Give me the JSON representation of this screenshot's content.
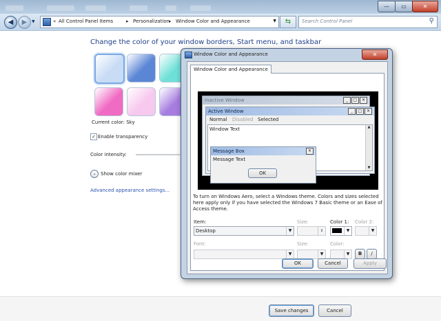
{
  "window": {
    "toolbar_ghosts": [
      "Arrange by",
      "Organize",
      "Include in library",
      "Share with",
      "Slide show",
      "Burn",
      "New folder"
    ],
    "min_glyph": "—",
    "max_glyph": "▭",
    "close_glyph": "✕"
  },
  "address": {
    "chevrons": "«",
    "crumbs": [
      "All Control Panel Items",
      "Personalization",
      "Window Color and Appearance"
    ],
    "sep": "▸",
    "search_placeholder": "Search Control Panel"
  },
  "main": {
    "title": "Change the color of your window borders, Start menu, and taskbar",
    "swatch_colors": [
      "#c9dcf6",
      "#5b86d6",
      "#6fe0d8",
      "#f06bc3",
      "#f7c9ee",
      "#a77de0"
    ],
    "current_color_label": "Current color:",
    "current_color_value": "Sky",
    "enable_transparency": "Enable transparency",
    "color_intensity": "Color intensity:",
    "show_color_mixer": "Show color mixer",
    "advanced_link": "Advanced appearance settings...",
    "save_button": "Save changes",
    "cancel_button": "Cancel"
  },
  "dialog": {
    "title": "Window Color and Appearance",
    "close_glyph": "✕",
    "tab": "Window Color and Appearance",
    "preview": {
      "inactive_title": "Inactive Window",
      "active_title": "Active Window",
      "menu_normal": "Normal",
      "menu_disabled": "Disabled",
      "menu_selected": "Selected",
      "window_text": "Window Text",
      "message_box_title": "Message Box",
      "message_text": "Message Text",
      "ok": "OK"
    },
    "info_text": "To turn on Windows Aero, select a Windows theme.  Colors and sizes selected here apply only if you have selected the Windows 7 Basic theme or an Ease of Access theme.",
    "item_label": "Item:",
    "item_value": "Desktop",
    "size_label": "Size:",
    "color1_label": "Color 1:",
    "color2_label": "Color 2:",
    "font_label": "Font:",
    "font_size_label": "Size:",
    "font_color_label": "Color:",
    "bold_label": "B",
    "italic_label": "/",
    "ok_button": "OK",
    "cancel_button": "Cancel",
    "apply_button": "Apply",
    "color1_value": "#000000"
  }
}
